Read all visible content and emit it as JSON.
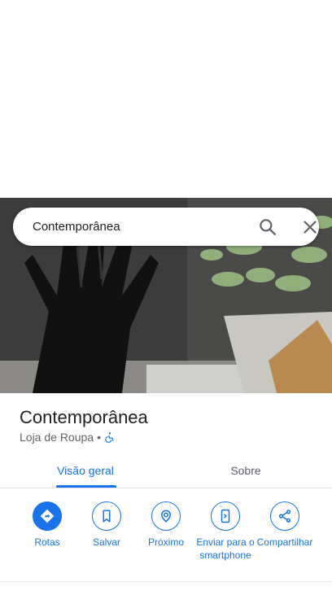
{
  "search": {
    "query": "Contemporânea"
  },
  "place": {
    "name": "Contemporânea",
    "category": "Loja de Roupa",
    "separator": "•"
  },
  "tabs": [
    {
      "label": "Visão geral",
      "active": true
    },
    {
      "label": "Sobre",
      "active": false
    }
  ],
  "actions": [
    {
      "label": "Rotas",
      "icon": "directions-icon"
    },
    {
      "label": "Salvar",
      "icon": "bookmark-icon"
    },
    {
      "label": "Próximo",
      "icon": "nearby-icon"
    },
    {
      "label": "Enviar para o smartphone",
      "icon": "send-to-phone-icon"
    },
    {
      "label": "Compartilhar",
      "icon": "share-icon"
    }
  ],
  "colors": {
    "accent": "#1a73e8",
    "text_primary": "#202124",
    "text_secondary": "#5f6368"
  }
}
